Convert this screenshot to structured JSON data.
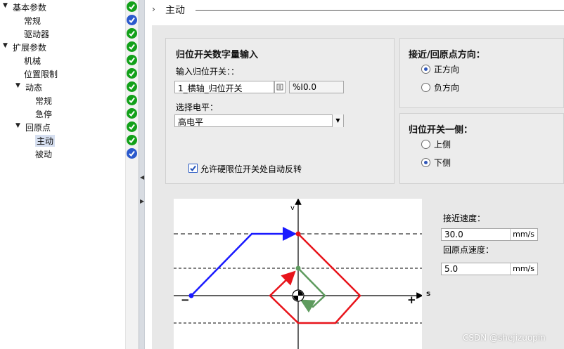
{
  "tree": [
    {
      "label": "基本参数",
      "arrow": "▼",
      "status": "green"
    },
    {
      "label": "常规",
      "arrow": "",
      "status": "blue"
    },
    {
      "label": "驱动器",
      "arrow": "",
      "status": "green"
    },
    {
      "label": "扩展参数",
      "arrow": "▼",
      "status": "green"
    },
    {
      "label": "机械",
      "arrow": "",
      "status": "green"
    },
    {
      "label": "位置限制",
      "arrow": "",
      "status": "green"
    },
    {
      "label": "动态",
      "arrow": "▼",
      "status": "green"
    },
    {
      "label": "常规",
      "arrow": "",
      "status": "green"
    },
    {
      "label": "急停",
      "arrow": "",
      "status": "green"
    },
    {
      "label": "回原点",
      "arrow": "▼",
      "status": "green"
    },
    {
      "label": "主动",
      "arrow": "",
      "status": "green",
      "selected": true
    },
    {
      "label": "被动",
      "arrow": "",
      "status": "blue"
    }
  ],
  "header": {
    "chevron": "›",
    "title": "主动"
  },
  "input_panel": {
    "title": "归位开关数字量输入",
    "input_label": "输入归位开关：：",
    "input_value": "1_横轴_归位开关",
    "address": "%I0.0",
    "level_label": "选择电平：",
    "level_value": "高电平",
    "auto_reverse_label": "允许硬限位开关处自动反转",
    "auto_reverse_checked": true
  },
  "direction_panel": {
    "title": "接近/回原点方向：",
    "options": [
      "正方向",
      "负方向"
    ],
    "selected": 0
  },
  "side_panel": {
    "title": "归位开关一侧：",
    "options": [
      "上侧",
      "下侧"
    ],
    "selected": 1
  },
  "diagram": {
    "v_label": "v",
    "s_label": "s",
    "minus": "−",
    "plus": "+"
  },
  "speeds": {
    "approach_label": "接近速度：",
    "approach_value": "30.0",
    "homing_label": "回原点速度：",
    "homing_value": "5.0",
    "unit": "mm/s"
  },
  "watermark": "CSDN @shejizuopin",
  "colors": {
    "blue": "#1a1aff",
    "red": "#e8141b",
    "green": "#5e9b5e",
    "check_green": "#12a019",
    "check_blue": "#2b59cc"
  }
}
